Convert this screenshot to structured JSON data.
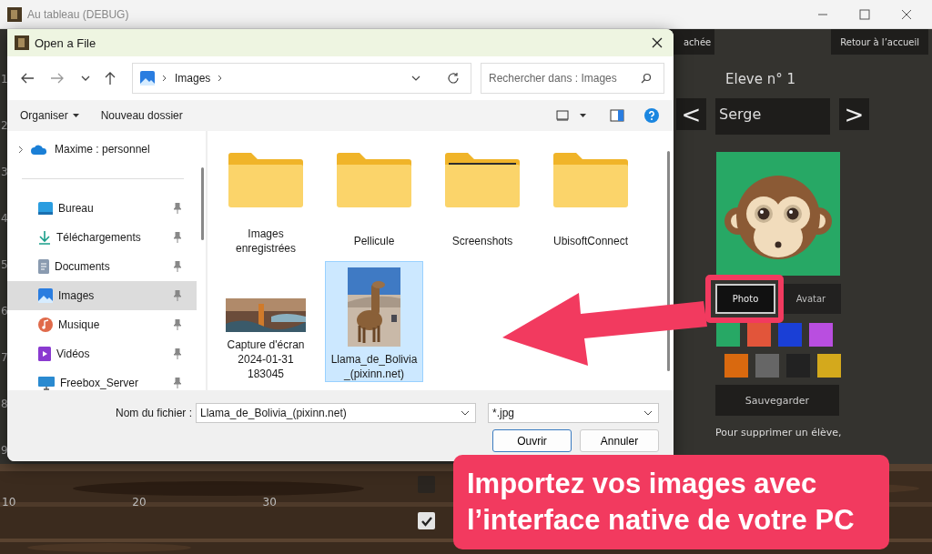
{
  "window": {
    "title": "Au tableau (DEBUG)"
  },
  "app": {
    "top_buttons": [
      "achée",
      "Retour à l’accueil"
    ],
    "row_numbers": [
      "1",
      "2",
      "3",
      "4",
      "5",
      "6",
      "7",
      "8",
      "9"
    ],
    "column_numbers": [
      "10",
      "20",
      "30"
    ],
    "checkboxes": [
      {
        "checked": false
      },
      {
        "checked": true
      }
    ],
    "heading": "Eleve n° 1",
    "prev": "<",
    "next": ">",
    "name": "Serge",
    "mode_tabs": [
      {
        "label": "Photo",
        "selected": true
      },
      {
        "label": "Avatar",
        "selected": false
      }
    ],
    "swatches": [
      {
        "color": "#27a865"
      },
      {
        "color": "#e2553a"
      },
      {
        "color": "#1a3fd6"
      },
      {
        "color": "#b94ee0"
      },
      {
        "color": "#d9690f"
      },
      {
        "color": "#666666"
      },
      {
        "color": "#222222"
      },
      {
        "color": "#d4a91c"
      }
    ],
    "save": "Sauvegarder",
    "hint": "Pour supprimer un élève,"
  },
  "dialog": {
    "title": "Open a File",
    "location": "Images",
    "search": {
      "placeholder": "Rechercher dans : Images"
    },
    "toolbar": {
      "organize": "Organiser",
      "new_folder": "Nouveau dossier"
    },
    "account": {
      "label": "Maxime : personnel",
      "expanded": false
    },
    "sidebar": [
      {
        "label": "Bureau",
        "kind": "desktop",
        "selected": false
      },
      {
        "label": "Téléchargements",
        "kind": "downloads",
        "selected": false
      },
      {
        "label": "Documents",
        "kind": "documents",
        "selected": false
      },
      {
        "label": "Images",
        "kind": "images",
        "selected": true
      },
      {
        "label": "Musique",
        "kind": "music",
        "selected": false
      },
      {
        "label": "Vidéos",
        "kind": "videos",
        "selected": false
      },
      {
        "label": "Freebox_Server",
        "kind": "network",
        "selected": false
      }
    ],
    "files": [
      {
        "name_lines": [
          "Images",
          "enregistrées"
        ],
        "kind": "folder",
        "selected": false
      },
      {
        "name_lines": [
          "Pellicule"
        ],
        "kind": "folder",
        "selected": false
      },
      {
        "name_lines": [
          "Screenshots"
        ],
        "kind": "folder_preview",
        "selected": false
      },
      {
        "name_lines": [
          "UbisoftConnect"
        ],
        "kind": "folder",
        "selected": false
      },
      {
        "name_lines": [
          "Capture d'écran",
          "2024-01-31",
          "183045"
        ],
        "kind": "picture_wide",
        "selected": false
      },
      {
        "name_lines": [
          "Llama_de_Bolivia",
          "_(pixinn.net)"
        ],
        "kind": "picture_tall",
        "selected": true
      }
    ],
    "file_name": {
      "label": "Nom du fichier :",
      "value": "Llama_de_Bolivia_(pixinn.net)"
    },
    "file_type": "*.jpg",
    "buttons": [
      {
        "label": "Ouvrir",
        "kind": "primary"
      },
      {
        "label": "Annuler",
        "kind": "secondary"
      }
    ]
  },
  "callout": {
    "lines": [
      "Importez vos images avec",
      "l’interface native de votre PC"
    ]
  }
}
